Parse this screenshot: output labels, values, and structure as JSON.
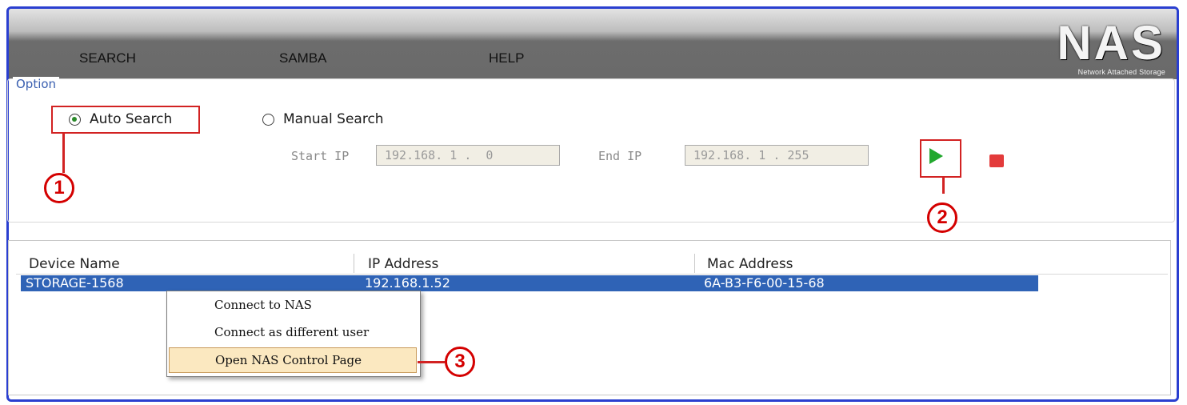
{
  "nav": {
    "search": "SEARCH",
    "samba": "SAMBA",
    "help": "HELP"
  },
  "logo": {
    "title": "NAS",
    "subtitle": "Network Attached Storage"
  },
  "option": {
    "legend": "Option",
    "auto_search": "Auto Search",
    "manual_search": "Manual Search",
    "auto_selected": true,
    "start_ip_label": "Start IP",
    "start_ip_value": "192.168. 1 .  0",
    "end_ip_label": "End IP",
    "end_ip_value": "192.168. 1 . 255"
  },
  "table": {
    "columns": [
      "Device Name",
      "IP Address",
      "Mac Address"
    ],
    "rows": [
      {
        "device_name": "STORAGE-1568",
        "ip_address": "192.168.1.52",
        "mac_address": "6A-B3-F6-00-15-68"
      }
    ]
  },
  "context_menu": {
    "items": [
      "Connect to NAS",
      "Connect as different user",
      "Open NAS Control Page"
    ],
    "highlighted_index": 2
  },
  "callouts": [
    "1",
    "2",
    "3"
  ],
  "colors": {
    "accent_red": "#d22222",
    "selection_blue": "#2f63b6",
    "play_green": "#22a82e",
    "window_border": "#2a3fd0"
  },
  "icons": {
    "play": "play-icon",
    "stop": "stop-icon"
  }
}
